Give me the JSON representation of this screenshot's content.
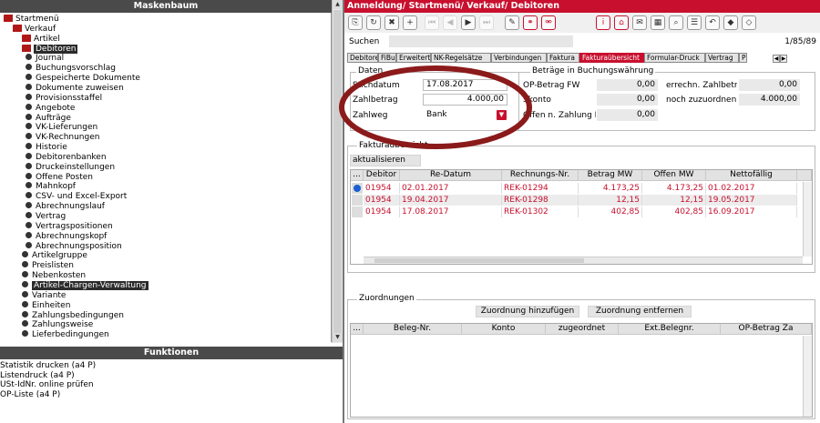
{
  "left_panel": {
    "title": "Maskenbaum",
    "tree": [
      {
        "label": "Startmenü",
        "type": "folder",
        "level": 0
      },
      {
        "label": "Verkauf",
        "type": "folder",
        "level": 1
      },
      {
        "label": "Artikel",
        "type": "folder",
        "level": 2
      },
      {
        "label": "Debitoren",
        "type": "folder",
        "level": 2,
        "selected": true
      },
      {
        "label": "Journal",
        "type": "item",
        "level": 3
      },
      {
        "label": "Buchungsvorschlag",
        "type": "item",
        "level": 3
      },
      {
        "label": "Gespeicherte Dokumente",
        "type": "item",
        "level": 3
      },
      {
        "label": "Dokumente zuweisen",
        "type": "item",
        "level": 3
      },
      {
        "label": "Provisionsstaffel",
        "type": "item",
        "level": 3
      },
      {
        "label": "Angebote",
        "type": "item",
        "level": 3
      },
      {
        "label": "Aufträge",
        "type": "item",
        "level": 3
      },
      {
        "label": "VK-Lieferungen",
        "type": "item",
        "level": 3
      },
      {
        "label": "VK-Rechnungen",
        "type": "item",
        "level": 3
      },
      {
        "label": "Historie",
        "type": "item",
        "level": 3
      },
      {
        "label": "Debitorenbanken",
        "type": "item",
        "level": 3
      },
      {
        "label": "Druckeinstellungen",
        "type": "item",
        "level": 3
      },
      {
        "label": "Offene Posten",
        "type": "item",
        "level": 3
      },
      {
        "label": "Mahnkopf",
        "type": "item",
        "level": 3
      },
      {
        "label": "CSV- und Excel-Export",
        "type": "item",
        "level": 3
      },
      {
        "label": "Abrechnungslauf",
        "type": "item",
        "level": 3
      },
      {
        "label": "Vertrag",
        "type": "item",
        "level": 3
      },
      {
        "label": "Vertragspositionen",
        "type": "item",
        "level": 3
      },
      {
        "label": "Abrechnungskopf",
        "type": "item",
        "level": 3
      },
      {
        "label": "Abrechnungsposition",
        "type": "item",
        "level": 3
      },
      {
        "label": "Artikelgruppe",
        "type": "item",
        "level": 2
      },
      {
        "label": "Preislisten",
        "type": "item",
        "level": 2
      },
      {
        "label": "Nebenkosten",
        "type": "item",
        "level": 2
      },
      {
        "label": "Artikel-Chargen-Verwaltung",
        "type": "item",
        "level": 2,
        "selected": true
      },
      {
        "label": "Variante",
        "type": "item",
        "level": 2
      },
      {
        "label": "Einheiten",
        "type": "item",
        "level": 2
      },
      {
        "label": "Zahlungsbedingungen",
        "type": "item",
        "level": 2
      },
      {
        "label": "Zahlungsweise",
        "type": "item",
        "level": 2
      },
      {
        "label": "Lieferbedingungen",
        "type": "item",
        "level": 2
      }
    ],
    "functions_title": "Funktionen",
    "functions": [
      "Statistik drucken (a4 P)",
      "Listendruck (a4 P)",
      "USt-IdNr. online prüfen",
      "OP-Liste (a4 P)"
    ]
  },
  "window": {
    "title": "Anmeldung/ Startmenü/ Verkauf/ Debitoren",
    "search_label": "Suchen",
    "search_value": "",
    "record_counter": "1/85/89"
  },
  "toolbar": {
    "icons": [
      "copy-icon",
      "refresh-icon",
      "delete-icon",
      "add-icon",
      "first-icon",
      "prev-icon",
      "next-icon",
      "last-icon",
      "edit-icon",
      "link-icon",
      "unlink-icon",
      "info-icon",
      "home-icon",
      "letter-icon",
      "grid-icon",
      "search-icon",
      "list-icon",
      "back-icon",
      "tag-icon",
      "eraser-icon"
    ]
  },
  "tabs": [
    {
      "label": "Debitoren",
      "active": false
    },
    {
      "label": "FiBu",
      "active": false
    },
    {
      "label": "Erweitert",
      "active": false
    },
    {
      "label": "NK-Regelsätze",
      "active": false
    },
    {
      "label": "Verbindungen",
      "active": false
    },
    {
      "label": "Faktura",
      "active": false
    },
    {
      "label": "Fakturaübersicht",
      "active": true
    },
    {
      "label": "Formular-Druck",
      "active": false
    },
    {
      "label": "Vertrag",
      "active": false
    },
    {
      "label": "P",
      "active": false
    }
  ],
  "daten": {
    "title": "Daten",
    "stichtag_label": "Stichdatum",
    "stichtag_value": "17.08.2017",
    "zahlbetrag_label": "Zahlbetrag",
    "zahlbetrag_value": "4.000,00",
    "zahlweg_label": "Zahlweg",
    "zahlweg_value": "Bank"
  },
  "betraege": {
    "title": "Beträge in Buchungswährung",
    "op_fw_label": "OP-Betrag FW",
    "op_fw_value": "0,00",
    "skonto_label": "Skonto",
    "skonto_value": "0,00",
    "offen_label": "Offen n. Zahlung FW",
    "offen_value": "0,00",
    "errechn_label": "errechn. Zahlbetrag",
    "errechn_value": "0,00",
    "noch_label": "noch zuzuordnen",
    "noch_value": "4.000,00"
  },
  "fakturaubersicht": {
    "title": "Fakturaübersicht",
    "refresh_label": "aktualisieren",
    "corner": "...",
    "columns": [
      "Debitor",
      "Re-Datum",
      "Rechnungs-Nr.",
      "Betrag MW",
      "Offen MW",
      "Nettofällig"
    ],
    "rows": [
      {
        "debitor": "01954",
        "datum": "02.01.2017",
        "nr": "REK-01294",
        "betrag": "4.173,25",
        "offen": "4.173,25",
        "faellig": "01.02.2017"
      },
      {
        "debitor": "01954",
        "datum": "19.04.2017",
        "nr": "REK-01298",
        "betrag": "12,15",
        "offen": "12,15",
        "faellig": "19.05.2017"
      },
      {
        "debitor": "01954",
        "datum": "17.08.2017",
        "nr": "REK-01302",
        "betrag": "402,85",
        "offen": "402,85",
        "faellig": "16.09.2017"
      }
    ]
  },
  "zuordnungen": {
    "title": "Zuordnungen",
    "add_label": "Zuordnung hinzufügen",
    "remove_label": "Zuordnung entfernen",
    "corner": "...",
    "columns": [
      "Beleg-Nr.",
      "Konto",
      "zugeordnet",
      "Ext.Belegnr.",
      "OP-Betrag Za"
    ]
  },
  "colors": {
    "accent": "#c8102e",
    "header_dark": "#4a4a4a",
    "annotation": "#8b1a1a"
  }
}
